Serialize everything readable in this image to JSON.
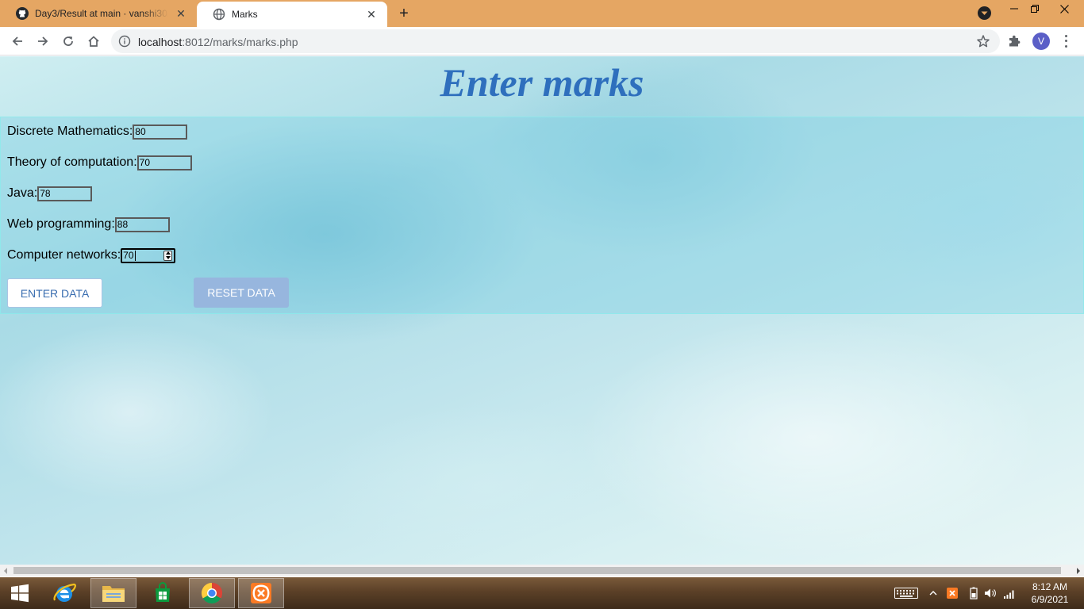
{
  "browser": {
    "tabs": [
      {
        "title": "Day3/Result at main · vanshi30/D",
        "icon": "github-icon"
      },
      {
        "title": "Marks",
        "icon": "globe-icon"
      }
    ],
    "new_tab_label": "+",
    "address": {
      "host": "localhost",
      "port_path": ":8012/marks/marks.php"
    },
    "profile_initial": "V"
  },
  "page": {
    "title": "Enter marks",
    "fields": [
      {
        "label": "Discrete Mathematics:",
        "value": "80"
      },
      {
        "label": "Theory of computation:",
        "value": "70"
      },
      {
        "label": "Java:",
        "value": "78"
      },
      {
        "label": "Web programming:",
        "value": "88"
      },
      {
        "label": "Computer networks:",
        "value": "70"
      }
    ],
    "buttons": {
      "enter": "ENTER DATA",
      "reset": "RESET DATA"
    }
  },
  "taskbar": {
    "apps": [
      "start-icon",
      "internet-explorer-icon",
      "file-explorer-icon",
      "store-icon",
      "chrome-icon",
      "xampp-icon"
    ],
    "clock": {
      "time": "8:12 AM",
      "date": "6/9/2021"
    }
  },
  "colors": {
    "titlebar": "#e5a663",
    "heading": "#2e6fbd",
    "reset_button": "#97b6de",
    "avatar": "#5b5fc7"
  }
}
